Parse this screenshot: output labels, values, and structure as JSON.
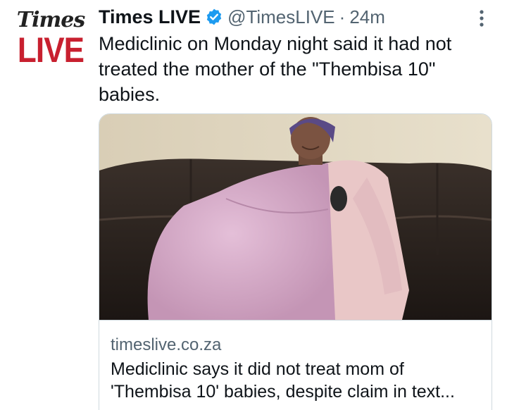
{
  "account": {
    "logo_top": "Times",
    "logo_bottom": "LIVE",
    "display_name": "Times LIVE",
    "handle": "@TimesLIVE",
    "separator": "·",
    "timestamp": "24m",
    "verified_icon": "verified-badge-icon",
    "more_icon": "vertical-ellipsis-icon"
  },
  "tweet": {
    "text": "Mediclinic on Monday night said it had not treated the mother of the \"Thembisa 10\" babies."
  },
  "card": {
    "image_icon": "photo-woman-seated-on-sofa",
    "domain": "timeslive.co.za",
    "title": "Mediclinic says it did not treat mom of 'Thembisa 10' babies, despite claim in text..."
  },
  "colors": {
    "brand_red": "#c8202f",
    "verified_blue": "#1d9bf0",
    "secondary_text": "#536471",
    "border": "#cfd9de"
  }
}
